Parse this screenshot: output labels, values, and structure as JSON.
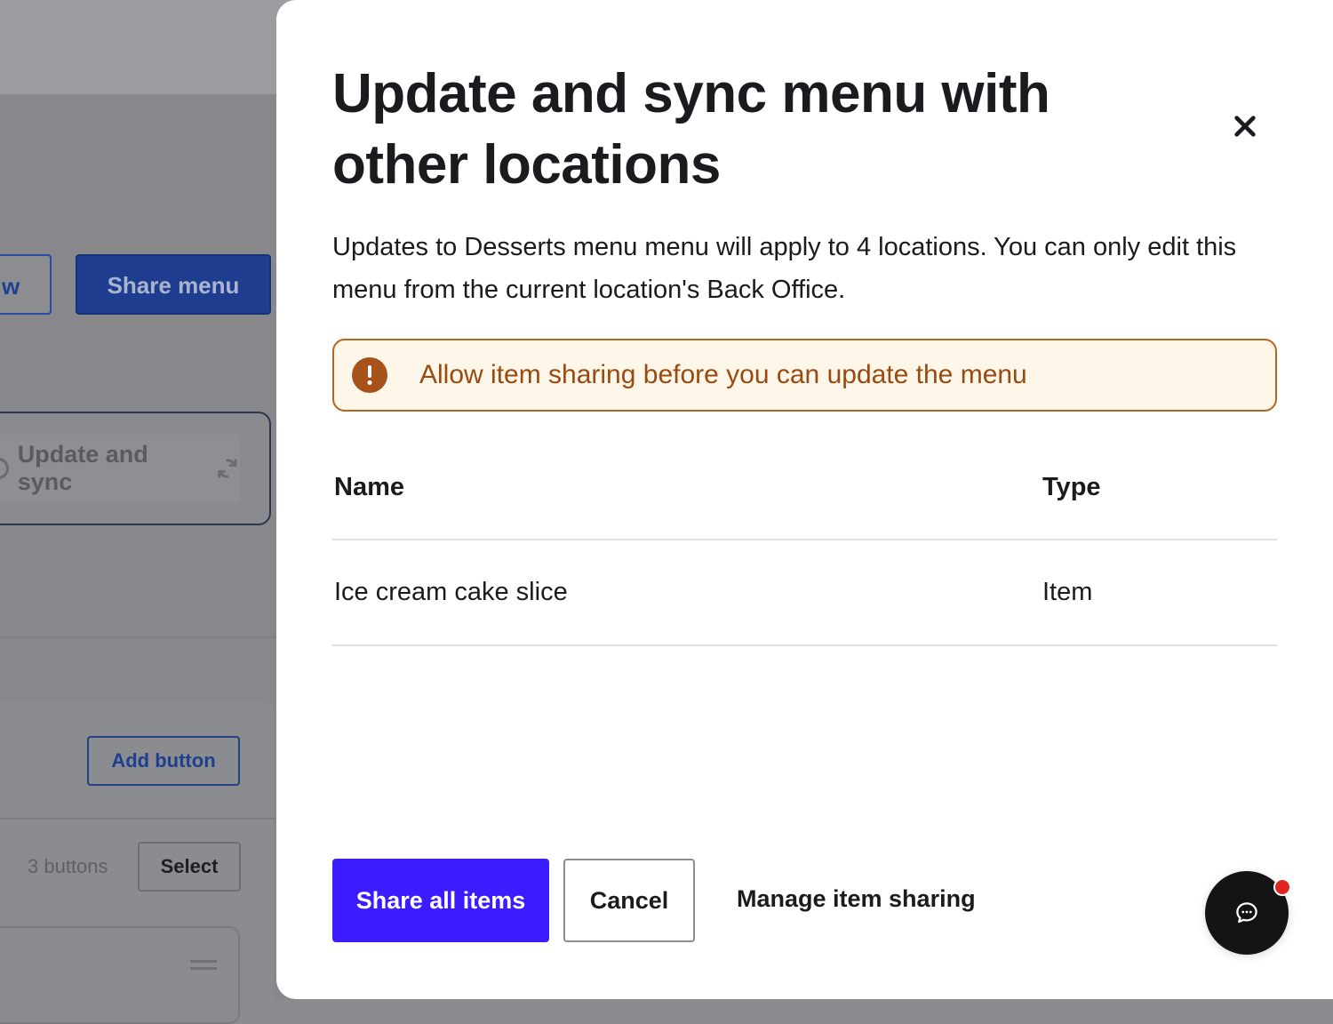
{
  "background": {
    "view_button_fragment": "w",
    "share_menu_label": "Share menu",
    "update_sync_label": "Update and sync",
    "add_button_label": "Add button",
    "button_count": "3 buttons",
    "select_label": "Select"
  },
  "modal": {
    "title": "Update and sync menu with other locations",
    "description": "Updates to Desserts menu menu will apply to 4 locations. You can only edit this menu from the current location's Back Office.",
    "alert": {
      "text": "Allow item sharing before you can update the menu",
      "icon": "exclamation-circle-icon",
      "color": "#a7521a",
      "background": "#fff6ea"
    },
    "table": {
      "columns": [
        "Name",
        "Type"
      ],
      "rows": [
        {
          "name": "Ice cream cake slice",
          "type": "Item"
        }
      ]
    },
    "actions": {
      "primary": "Share all items",
      "secondary": "Cancel",
      "link": "Manage item sharing"
    },
    "close_icon": "close-icon",
    "chat_icon": "chat-bubble-icon"
  },
  "colors": {
    "primary": "#3a1cff",
    "warning_border": "#b8641e",
    "notification_dot": "#e02424"
  }
}
